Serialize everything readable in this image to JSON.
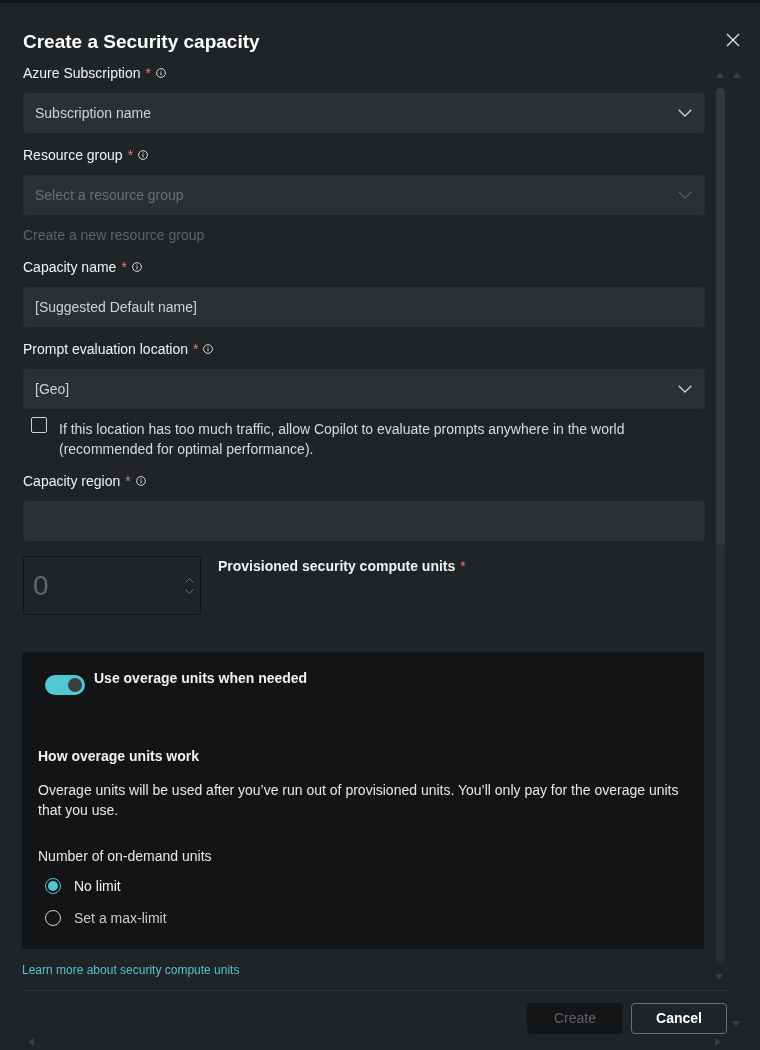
{
  "dialog": {
    "title": "Create a Security capacity"
  },
  "fields": [
    {
      "kind": "dropdown",
      "label": "Azure Subscription",
      "required_mark": "*",
      "value": "Subscription name",
      "disabled": false
    },
    {
      "kind": "dropdown",
      "label": "Resource group",
      "required_mark": "*",
      "placeholder": "Select a resource group",
      "disabled": true,
      "helper_link": {
        "text": "Create a new resource group",
        "disabled": true
      }
    },
    {
      "kind": "text",
      "label": "Capacity name",
      "required_mark": "*",
      "value": "[Suggested Default name]"
    },
    {
      "kind": "dropdown",
      "label": "Prompt evaluation location",
      "required_mark": "*",
      "value": "[Geo]",
      "disabled": false,
      "checkbox": {
        "label": "If this location has too much traffic, allow Copilot to evaluate prompts anywhere in the world (recommended for optimal performance).",
        "checked": false
      }
    },
    {
      "kind": "text",
      "label": "Capacity region",
      "required_mark": "*"
    }
  ],
  "compute_units": {
    "placeholder": "0",
    "label": "Provisioned security compute units",
    "required_mark": "*"
  },
  "overage": {
    "toggle": {
      "label": "Use overage units when needed",
      "on": true
    },
    "heading": "How overage units work",
    "description": "Overage units will be used after you’ve run out of provisioned units. You’ll only pay for the overage units that you use.",
    "radio_group": {
      "label": "Number of on-demand units",
      "options": [
        {
          "label": "No limit",
          "selected": true
        },
        {
          "label": "Set a max-limit",
          "selected": false
        }
      ]
    }
  },
  "learn_more_link": "Learn more about security compute units",
  "buttons": [
    {
      "label": "Create",
      "kind": "primary",
      "disabled": true
    },
    {
      "label": "Cancel",
      "kind": "secondary",
      "disabled": false
    }
  ]
}
